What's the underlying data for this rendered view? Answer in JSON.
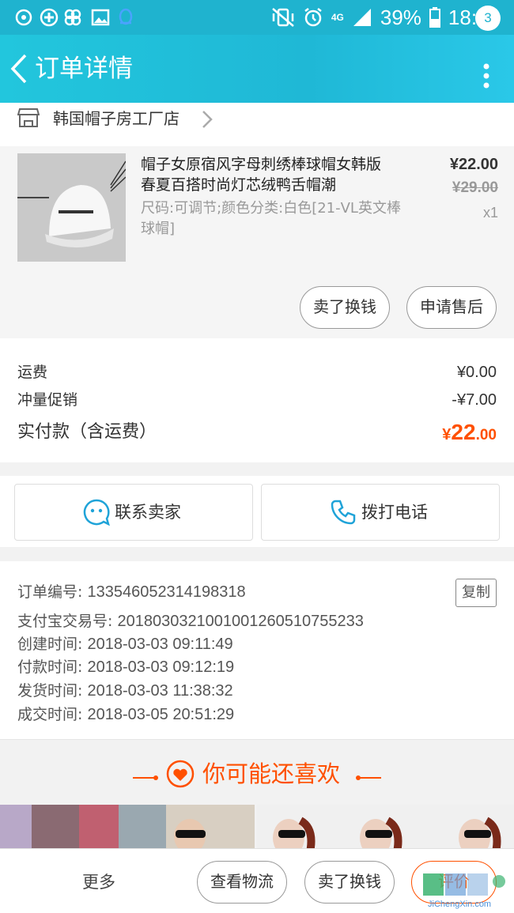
{
  "status_bar": {
    "battery": "39%",
    "time": "18:26",
    "network": "4G"
  },
  "nav": {
    "title": "订单详情",
    "badge_count": "3"
  },
  "shop": {
    "name": "韩国帽子房工厂店"
  },
  "product": {
    "title": "帽子女原宿风字母刺绣棒球帽女韩版春夏百搭时尚灯芯绒鸭舌帽潮",
    "sku": "尺码:可调节;颜色分类:白色[21-VL英文棒球帽]",
    "price": "¥22.00",
    "original_price": "¥29.00",
    "quantity": "x1",
    "actions": [
      "卖了换钱",
      "申请售后"
    ]
  },
  "fees": {
    "shipping_label": "运费",
    "shipping_value": "¥0.00",
    "promo_label": "冲量促销",
    "promo_value": "-¥7.00",
    "total_label": "实付款（含运费）",
    "total_currency": "¥",
    "total_int": "22",
    "total_dec": ".00"
  },
  "contact": {
    "seller_label": "联系卖家",
    "phone_label": "拨打电话"
  },
  "order_info": {
    "order_no_label": "订单编号:",
    "order_no": "133546052314198318",
    "copy_label": "复制",
    "alipay_label": "支付宝交易号:",
    "alipay_no": "2018030321001001260510755233",
    "created_label": "创建时间:",
    "created": "2018-03-03 09:11:49",
    "paid_label": "付款时间:",
    "paid": "2018-03-03 09:12:19",
    "shipped_label": "发货时间:",
    "shipped": "2018-03-03 11:38:32",
    "completed_label": "成交时间:",
    "completed": "2018-03-05 20:51:29"
  },
  "recommend": {
    "title": "你可能还喜欢"
  },
  "bottom_bar": {
    "more_label": "更多",
    "logistics_label": "查看物流",
    "resell_label": "卖了换钱",
    "review_label": "评价"
  },
  "colors": {
    "accent": "#ff5000",
    "brand": "#1fb3cf"
  },
  "watermark": {
    "text": "JiChengXin.com"
  }
}
